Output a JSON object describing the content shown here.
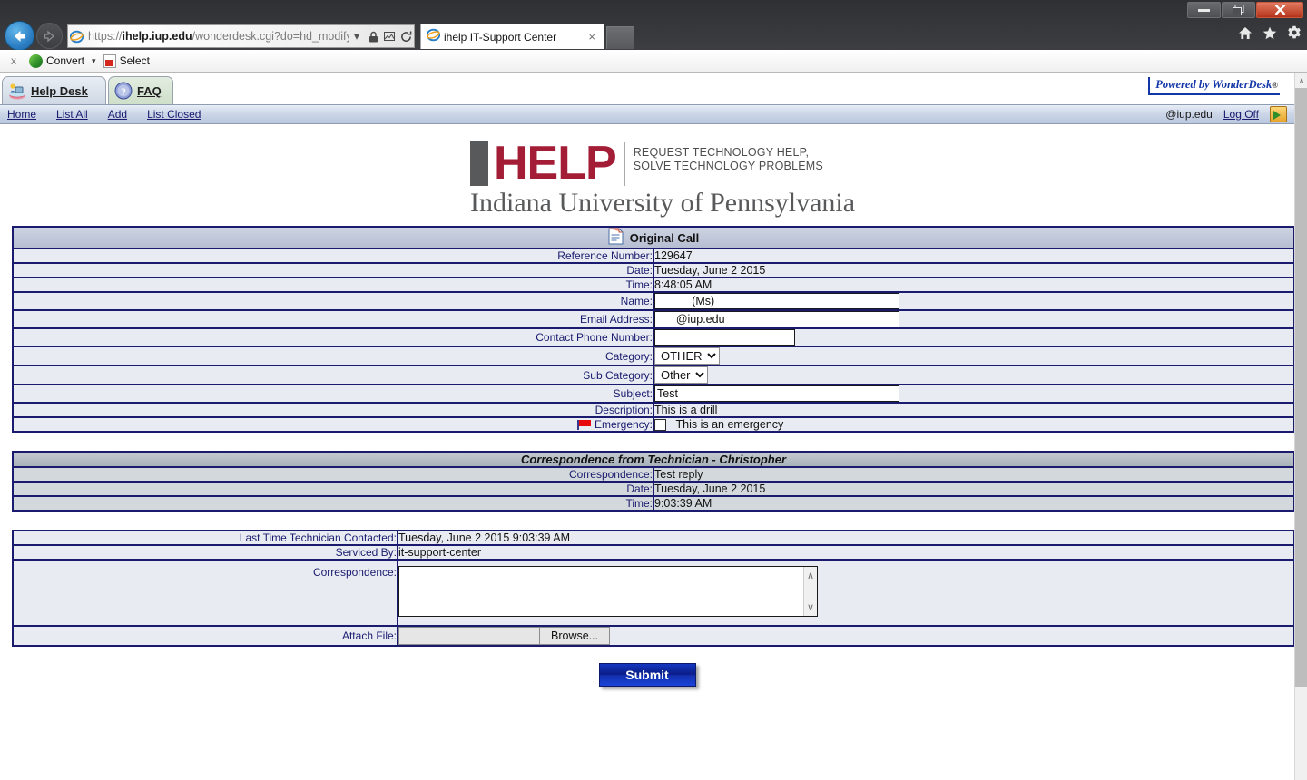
{
  "window": {
    "minimize_label": "minimize",
    "restore_label": "restore",
    "close_label": "close"
  },
  "browser": {
    "back_label": "Back",
    "forward_label": "Forward",
    "url_scheme": "https",
    "url_host": "ihelp.iup.edu",
    "url_path": "/wonderdesk.cgi?do=hd_modify_re",
    "url_full": "https://ihelp.iup.edu/wonderdesk.cgi?do=hd_modify_re",
    "tab_title": "ihelp IT-Support Center",
    "tab_close": "×",
    "new_tab_label": "",
    "icons": {
      "dropdown": "▾",
      "lock": "🔒",
      "compat": "❑",
      "refresh": "↻",
      "home": "home-icon",
      "favorites": "favorites-icon",
      "tools": "tools-icon"
    }
  },
  "command_bar": {
    "close_label": "x",
    "convert_label": "Convert",
    "dropdown_label": "▾",
    "select_label": "Select"
  },
  "app_tabs": [
    {
      "label": "Help Desk",
      "active": true,
      "icon": "helpdesk-icon"
    },
    {
      "label": "FAQ",
      "active": false,
      "icon": "faq-icon"
    }
  ],
  "nav": {
    "links": [
      "Home",
      "List All",
      "Add",
      "List Closed"
    ],
    "user_email": "@iup.edu",
    "logoff_label": "Log Off",
    "powered_by": "Powered by WonderDesk",
    "powered_reg": "®"
  },
  "logo": {
    "mark_i": "I",
    "mark_help": "HELP",
    "tagline_line1": "REQUEST TECHNOLOGY HELP,",
    "tagline_line2": "SOLVE TECHNOLOGY PROBLEMS",
    "university": "Indiana University of Pennsylvania"
  },
  "original_call": {
    "header": "Original Call",
    "rows": [
      {
        "label": "Reference Number:",
        "value": "129647",
        "type": "text"
      },
      {
        "label": "Date:",
        "value": "Tuesday, June 2 2015",
        "type": "text"
      },
      {
        "label": "Time:",
        "value": "8:48:05 AM",
        "type": "text"
      },
      {
        "label": "Name:",
        "value": "           (Ms)",
        "type": "input"
      },
      {
        "label": "Email Address:",
        "value": "      @iup.edu",
        "type": "input"
      },
      {
        "label": "Contact Phone Number:",
        "value": "",
        "type": "input-small"
      },
      {
        "label": "Category:",
        "value": "OTHER",
        "type": "select"
      },
      {
        "label": "Sub Category:",
        "value": "Other",
        "type": "select"
      },
      {
        "label": "Subject:",
        "value": "Test",
        "type": "input"
      },
      {
        "label": "Description:",
        "value": "This is a drill",
        "type": "text"
      },
      {
        "label": "Emergency:",
        "value": "This is an emergency",
        "type": "checkbox",
        "checked": false,
        "has_flag": true
      }
    ]
  },
  "correspondence_section": {
    "header": "Correspondence from Technician - Christopher",
    "rows": [
      {
        "label": "Correspondence:",
        "value": "Test reply"
      },
      {
        "label": "Date:",
        "value": "Tuesday, June 2 2015"
      },
      {
        "label": "Time:",
        "value": "9:03:39 AM"
      }
    ]
  },
  "reply_section": {
    "rows": [
      {
        "label": "Last Time Technician Contacted:",
        "value": "Tuesday, June 2 2015 9:03:39 AM"
      },
      {
        "label": "Serviced By:",
        "value": "it-support-center"
      }
    ],
    "correspondence_label": "Correspondence:",
    "correspondence_value": "",
    "correspondence_placeholder": "",
    "attach_label": "Attach File:",
    "attach_value": "",
    "browse_label": "Browse..."
  },
  "submit": {
    "label": "Submit"
  },
  "scrollbar": {
    "up": "∧",
    "down": "∨"
  },
  "colors": {
    "label_blue": "#1a1a6e",
    "row_bg": "#e8ecf2",
    "section_header": "#b6bed2",
    "gray_section": "#d3d8dc",
    "logo_red": "#a31d36",
    "logo_gray": "#58595b",
    "submit_blue": "#0a1c86",
    "wonderdesk_blue": "#1437a8"
  }
}
